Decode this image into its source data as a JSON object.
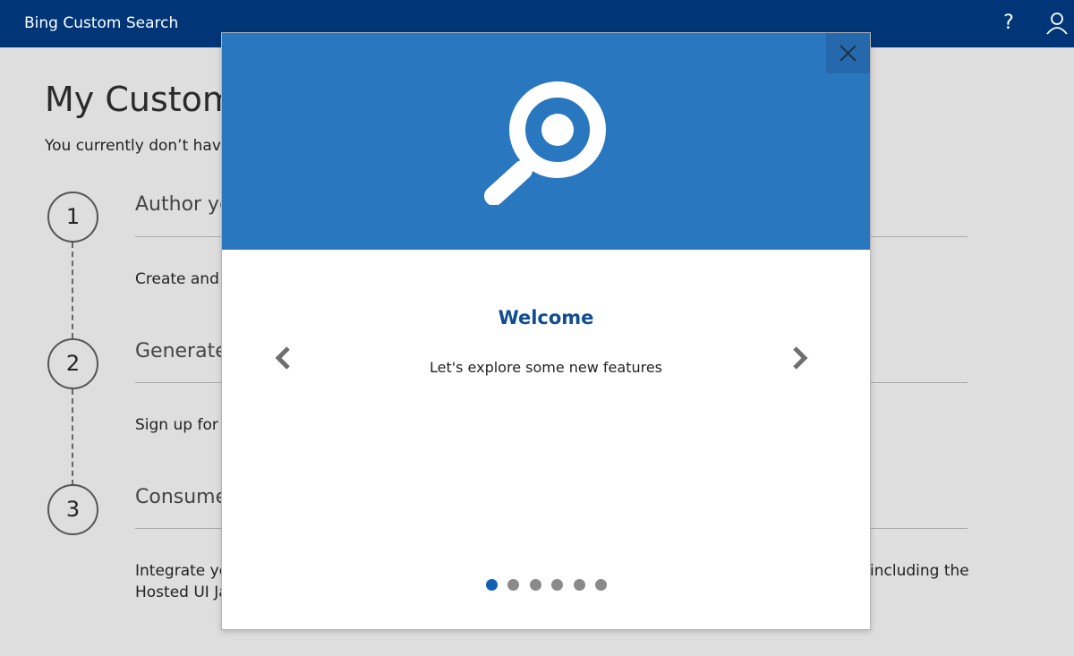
{
  "header": {
    "title": "Bing Custom Search",
    "help_label": "?"
  },
  "page": {
    "title": "My Custom",
    "subtitle": "You currently don’t have",
    "steps": [
      {
        "number": "1",
        "heading": "Author yo",
        "description": "Create and c",
        "description_right": ""
      },
      {
        "number": "2",
        "heading": "Generate",
        "description": "Sign up for a",
        "description_right": ""
      },
      {
        "number": "3",
        "heading": "Consume",
        "description": "Integrate yo",
        "description_line2": "Hosted UI Ja",
        "description_right": "including the"
      }
    ]
  },
  "modal": {
    "icon": "search-icon",
    "title": "Welcome",
    "text": "Let's explore some new features",
    "dots_total": 6,
    "active_dot": 1
  },
  "colors": {
    "header_bg": "#003677",
    "hero_bg": "#2877bf",
    "accent": "#0f4e93",
    "active_dot": "#0f62b3"
  }
}
